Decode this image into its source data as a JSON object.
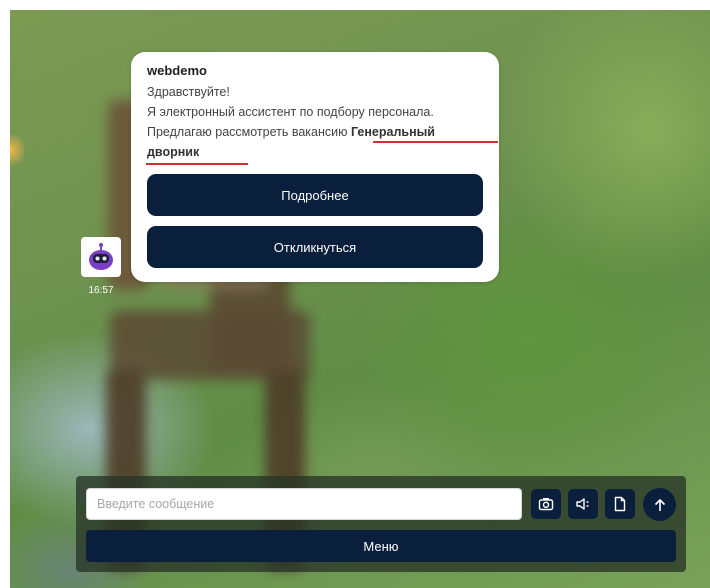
{
  "chat": {
    "avatar_icon": "robot-icon",
    "time": "16:57",
    "message": {
      "sender": "webdemo",
      "greeting": "Здравствуйте!",
      "intro": "Я электронный ассистент по подбору персонала.",
      "offer_prefix": "Предлагаю рассмотреть вакансию ",
      "vacancy": "Генеральный дворник",
      "buttons": [
        {
          "label": "Подробнее"
        },
        {
          "label": "Откликнуться"
        }
      ]
    }
  },
  "composer": {
    "placeholder": "Введите сообщение",
    "value": "",
    "icons": [
      "camera-icon",
      "speaker-icon",
      "file-icon",
      "send-arrow-icon"
    ],
    "menu_label": "Меню"
  },
  "colors": {
    "button": "#0a1f3c",
    "underline": "#d0322f",
    "avatar_purple": "#7b3fc4"
  }
}
